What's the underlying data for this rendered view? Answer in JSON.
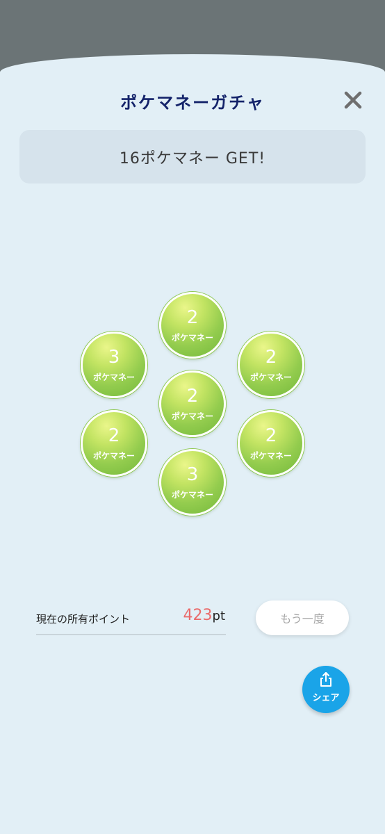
{
  "modal": {
    "title": "ポケマネーガチャ",
    "close_icon": "close-icon"
  },
  "result": {
    "banner_text": "16ポケマネー GET!"
  },
  "coins": [
    {
      "value": "2",
      "unit": "ポケマネー"
    },
    {
      "value": "3",
      "unit": "ポケマネー"
    },
    {
      "value": "2",
      "unit": "ポケマネー"
    },
    {
      "value": "2",
      "unit": "ポケマネー"
    },
    {
      "value": "2",
      "unit": "ポケマネー"
    },
    {
      "value": "2",
      "unit": "ポケマネー"
    },
    {
      "value": "3",
      "unit": "ポケマネー"
    }
  ],
  "points": {
    "label": "現在の所有ポイント",
    "value": "423",
    "unit": "pt"
  },
  "retry_button": {
    "label": "もう一度"
  },
  "share_button": {
    "label": "シェア",
    "icon": "share-icon"
  },
  "colors": {
    "title": "#14236a",
    "background": "#e2eff6",
    "accent_blue": "#1aa4e8",
    "points_value": "#ea6a6a",
    "coin_green": "#93cc4e"
  }
}
